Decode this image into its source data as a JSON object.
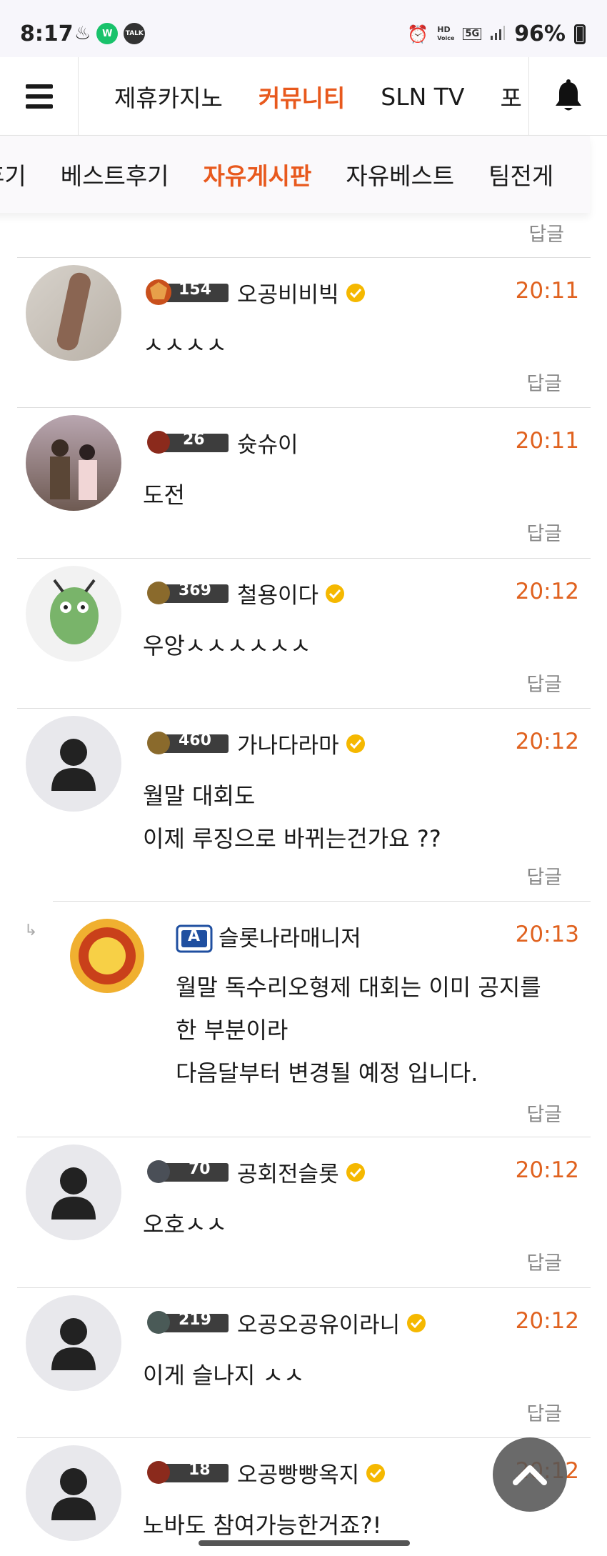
{
  "status_bar": {
    "time": "8:17",
    "battery": "96%",
    "hd": "HD",
    "voice": "Voice",
    "network": "5G",
    "talk": "TALK"
  },
  "top_nav": {
    "items": [
      {
        "label": "제휴카지노",
        "active": false
      },
      {
        "label": "커뮤니티",
        "active": true
      },
      {
        "label": "SLN TV",
        "active": false
      },
      {
        "label": "포",
        "active": false
      }
    ]
  },
  "sub_nav": {
    "items": [
      {
        "label": "후기",
        "active": false
      },
      {
        "label": "베스트후기",
        "active": false
      },
      {
        "label": "자유게시판",
        "active": true
      },
      {
        "label": "자유베스트",
        "active": false
      },
      {
        "label": "팀전게",
        "active": false
      }
    ]
  },
  "reply_label": "답글",
  "comments": [
    {
      "level": "154",
      "nickname": "오공비비빅",
      "verified": true,
      "time": "20:11",
      "content": "ㅅㅅㅅㅅ",
      "badge_color": "#c9501c"
    },
    {
      "level": "26",
      "nickname": "슛슈이",
      "verified": false,
      "time": "20:11",
      "content": "도전",
      "badge_color": "#8b2a1c"
    },
    {
      "level": "369",
      "nickname": "철용이다",
      "verified": true,
      "time": "20:12",
      "content": "우앙ㅅㅅㅅㅅㅅㅅ",
      "badge_color": "#8a6a2c"
    },
    {
      "level": "460",
      "nickname": "가나다라마",
      "verified": true,
      "time": "20:12",
      "content": "월말 대회도\n이제 루징으로 바뀌는건가요 ??",
      "badge_color": "#8a6a2c"
    },
    {
      "level": "A",
      "nickname": "슬롯나라매니저",
      "verified": false,
      "time": "20:13",
      "content": "월말 독수리오형제 대회는 이미 공지를\n한 부분이라\n다음달부터 변경될 예정 입니다.",
      "nested": true,
      "badge_color": "#1f4fa0"
    },
    {
      "level": "70",
      "nickname": "공회전슬롯",
      "verified": true,
      "time": "20:12",
      "content": "오호ㅅㅅ",
      "badge_color": "#4a4f57"
    },
    {
      "level": "219",
      "nickname": "오공오공유이라니",
      "verified": true,
      "time": "20:12",
      "content": "이게 슬나지 ㅅㅅ",
      "badge_color": "#4a5a57"
    },
    {
      "level": "18",
      "nickname": "오공빵빵옥지",
      "verified": true,
      "time": "20:12",
      "content": "노바도 참여가능한거죠?!",
      "badge_color": "#8b2a1c"
    }
  ],
  "icons": {
    "menu": "hamburger-menu-icon",
    "bell": "bell-icon",
    "scroll_top": "chevron-up-icon",
    "verified": "verified-check-icon"
  },
  "colors": {
    "accent": "#e8591d",
    "time": "#e0621f",
    "verified": "#f5b800"
  }
}
